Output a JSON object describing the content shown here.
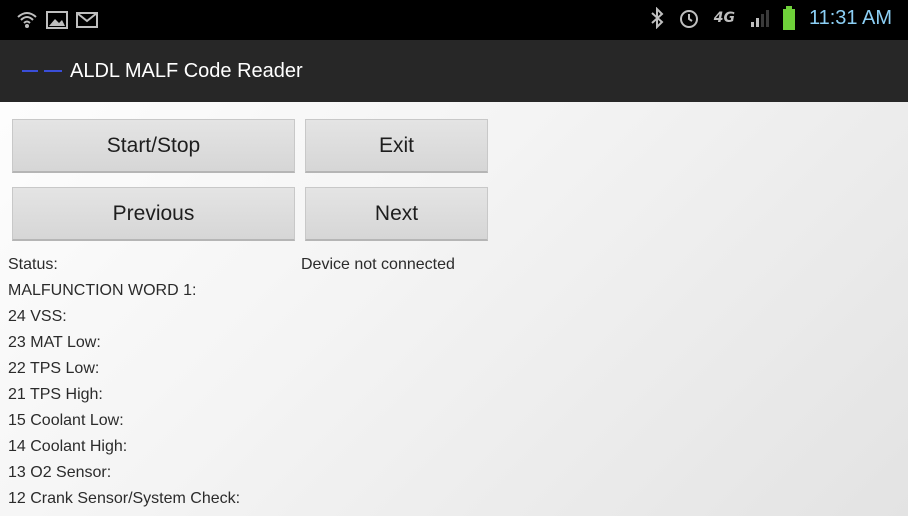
{
  "status_bar": {
    "time": "11:31 AM",
    "network": "4G",
    "icons": [
      "wifi-icon",
      "image-icon",
      "mail-icon",
      "bluetooth-icon",
      "alarm-icon",
      "network-4g-icon",
      "signal-icon",
      "battery-icon"
    ]
  },
  "action_bar": {
    "title": "ALDL MALF Code Reader"
  },
  "buttons": {
    "start_stop": "Start/Stop",
    "exit": "Exit",
    "previous": "Previous",
    "next": "Next"
  },
  "status": {
    "label": "Status:",
    "value": "Device not connected"
  },
  "codes": {
    "header": "MALFUNCTION WORD 1:",
    "items": [
      "24 VSS:",
      "23 MAT Low:",
      "22 TPS Low:",
      "21 TPS High:",
      "15 Coolant Low:",
      "14 Coolant High:",
      "13 O2 Sensor:",
      "12 Crank Sensor/System Check:"
    ]
  }
}
